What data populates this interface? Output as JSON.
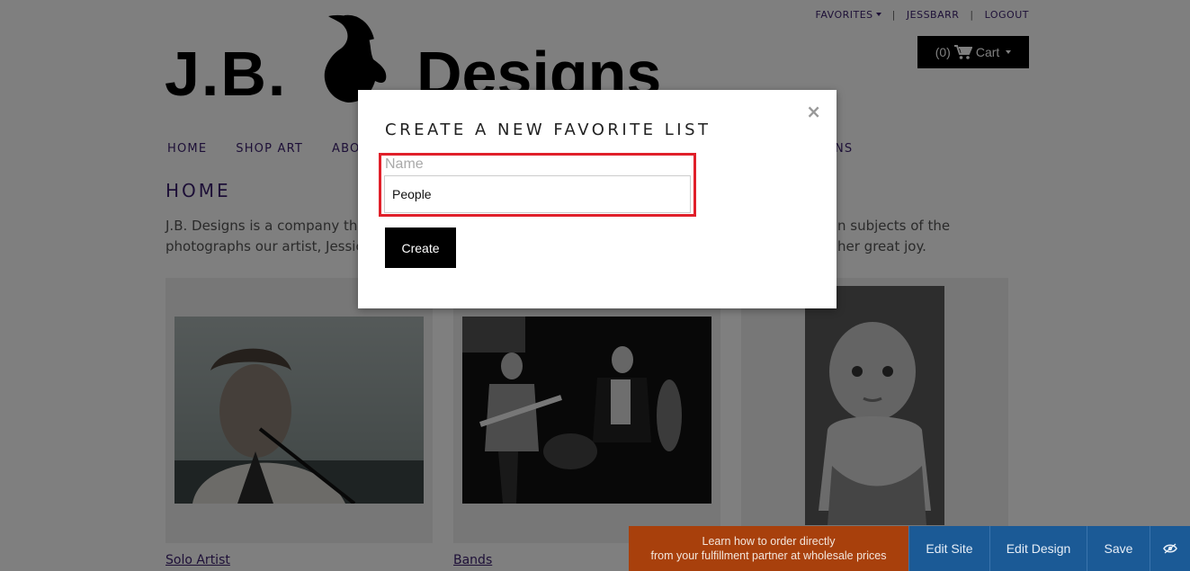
{
  "header": {
    "favorites_label": "FAVORITES",
    "user_label": "JESSBARR",
    "logout_label": "LOGOUT",
    "separator": "|",
    "cart_count": "(0)",
    "cart_label": "Cart"
  },
  "logo": {
    "left_text": "J.B.",
    "right_text": "Designs"
  },
  "nav": {
    "home": "HOME",
    "shop_art": "SHOP ART",
    "about_partial": "ABO",
    "tail_partial": "NS"
  },
  "page": {
    "title": "HOME",
    "intro_line1_left": "J.B. Designs is a company th",
    "intro_line1_right": "n subjects of the",
    "intro_line2_left": "photographs our artist, Jessic",
    "intro_line2_right": "her great joy."
  },
  "gallery": [
    {
      "label": "Solo Artist"
    },
    {
      "label": "Bands"
    },
    {
      "label": ""
    }
  ],
  "modal": {
    "title": "CREATE A NEW FAVORITE LIST",
    "close_glyph": "×",
    "name_label": "Name",
    "name_value": "People",
    "create_label": "Create"
  },
  "editor_bar": {
    "promo_line1": "Learn how to order directly",
    "promo_line2": "from your fulfillment partner at wholesale prices",
    "edit_site": "Edit Site",
    "edit_design": "Edit Design",
    "save": "Save"
  },
  "colors": {
    "accent_purple": "#3a1f6e",
    "highlight_red": "#e0202a",
    "promo_orange": "#a8400c",
    "toolbar_blue": "#1b5a96"
  },
  "icons": [
    "cart-icon",
    "caret-down-icon",
    "close-icon",
    "eye-icon",
    "goat-logo-icon"
  ]
}
